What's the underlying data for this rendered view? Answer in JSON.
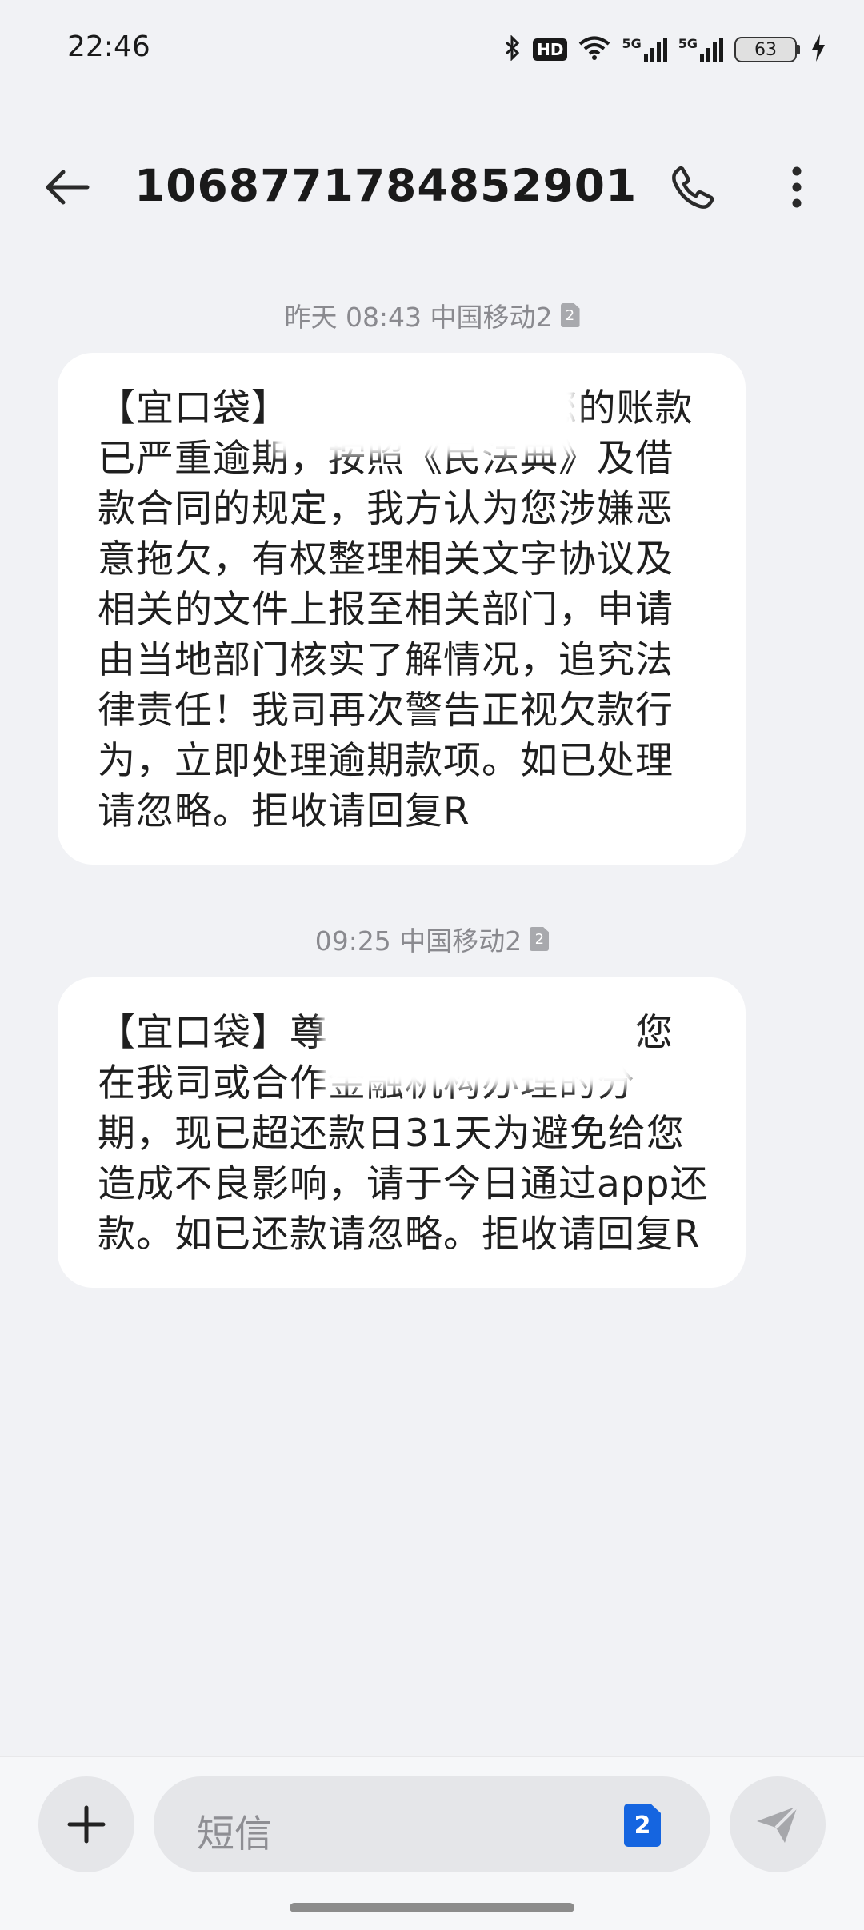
{
  "status_bar": {
    "time": "22:46",
    "hd_label": "HD",
    "sim1_network": "5G",
    "sim2_network": "5G",
    "battery_level": "63",
    "icons": [
      "bluetooth-icon",
      "hd-voice-icon",
      "wifi-icon",
      "signal-5g-icon",
      "signal-5g-icon",
      "battery-icon",
      "charging-icon"
    ]
  },
  "header": {
    "title": "1068771784852901",
    "icons": [
      "back-arrow-icon",
      "phone-icon",
      "more-vertical-icon"
    ]
  },
  "messages": [
    {
      "timestamp": "昨天 08:43 中国移动2",
      "sim_badge": "2",
      "text": "【宜口袋】　　　　　　　您的账款已严重逾期，按照《民法典》及借款合同的规定，我方认为您涉嫌恶意拖欠，有权整理相关文字协议及相关的文件上报至相关部门，申请由当地部门核实了解情况，追究法律责任！我司再次警告正视欠款行为，立即处理逾期款项。如已处理请忽略。拒收请回复R"
    },
    {
      "timestamp": "09:25 中国移动2",
      "sim_badge": "2",
      "text": "【宜口袋】尊　　　　　　户，您在我司或合作金融机构办理的分期，现已超还款日31天为避免给您造成不良影响，请于今日通过app还款。如已还款请忽略。拒收请回复R"
    }
  ],
  "compose": {
    "placeholder": "短信",
    "sim_badge": "2",
    "icons": [
      "plus-icon",
      "sim-card-icon",
      "send-icon"
    ]
  },
  "colors": {
    "background": "#f1f2f5",
    "bubble": "#ffffff",
    "accent": "#1565e0",
    "muted_text": "#8a8a8f"
  }
}
